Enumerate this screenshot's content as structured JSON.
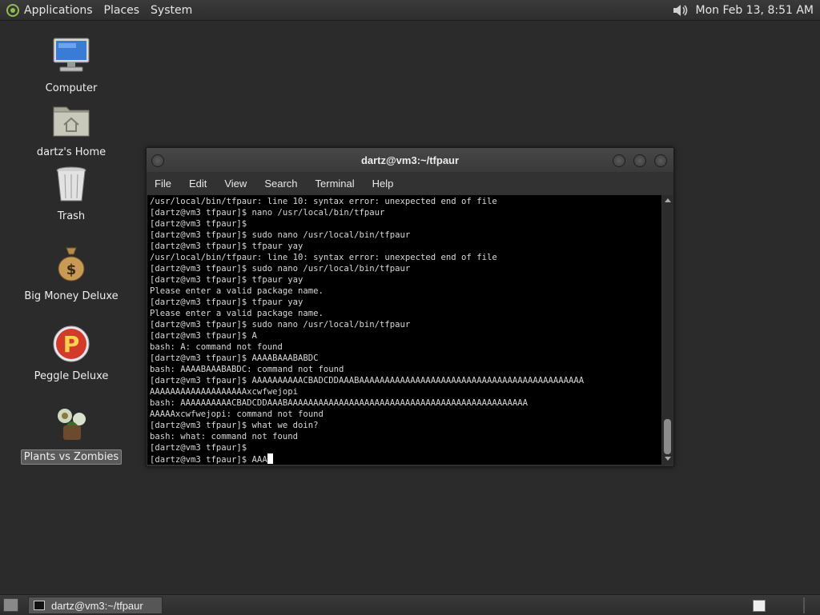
{
  "top_panel": {
    "menus": [
      "Applications",
      "Places",
      "System"
    ],
    "clock": "Mon Feb 13,  8:51 AM"
  },
  "desktop_icons": [
    {
      "label": "Computer",
      "icon": "computer-icon"
    },
    {
      "label": "dartz's Home",
      "icon": "home-folder-icon"
    },
    {
      "label": "Trash",
      "icon": "trash-icon"
    },
    {
      "label": "Big Money Deluxe",
      "icon": "money-bag-icon"
    },
    {
      "label": "Peggle Deluxe",
      "icon": "peggle-icon"
    },
    {
      "label": "Plants vs Zombies",
      "icon": "plants-vs-zombies-icon"
    }
  ],
  "terminal": {
    "title": "dartz@vm3:~/tfpaur",
    "menu": [
      "File",
      "Edit",
      "View",
      "Search",
      "Terminal",
      "Help"
    ],
    "lines": [
      "/usr/local/bin/tfpaur: line 10: syntax error: unexpected end of file",
      "[dartz@vm3 tfpaur]$ nano /usr/local/bin/tfpaur",
      "[dartz@vm3 tfpaur]$",
      "[dartz@vm3 tfpaur]$ sudo nano /usr/local/bin/tfpaur",
      "[dartz@vm3 tfpaur]$ tfpaur yay",
      "/usr/local/bin/tfpaur: line 10: syntax error: unexpected end of file",
      "[dartz@vm3 tfpaur]$ sudo nano /usr/local/bin/tfpaur",
      "[dartz@vm3 tfpaur]$ tfpaur yay",
      "Please enter a valid package name.",
      "[dartz@vm3 tfpaur]$ tfpaur yay",
      "Please enter a valid package name.",
      "[dartz@vm3 tfpaur]$ sudo nano /usr/local/bin/tfpaur",
      "[dartz@vm3 tfpaur]$ A",
      "bash: A: command not found",
      "[dartz@vm3 tfpaur]$ AAAABAAABABDC",
      "bash: AAAABAAABABDC: command not found",
      "[dartz@vm3 tfpaur]$ AAAAAAAAAACBADCDDAAABAAAAAAAAAAAAAAAAAAAAAAAAAAAAAAAAAAAAAAAAAAAA",
      "AAAAAAAAAAAAAAAAAAAxcwfwejopi",
      "bash: AAAAAAAAAACBADCDDAAABAAAAAAAAAAAAAAAAAAAAAAAAAAAAAAAAAAAAAAAAAAAAAAA",
      "AAAAAxcwfwejopi: command not found",
      "[dartz@vm3 tfpaur]$ what we doin?",
      "bash: what: command not found",
      "[dartz@vm3 tfpaur]$",
      "[dartz@vm3 tfpaur]$ AAA"
    ]
  },
  "bottom_panel": {
    "task_label": "dartz@vm3:~/tfpaur"
  }
}
